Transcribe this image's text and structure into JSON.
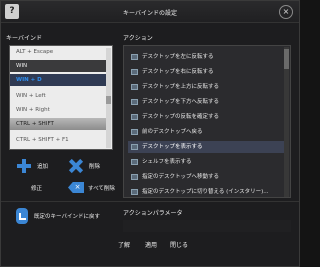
{
  "title": "キーバインドの設定",
  "left_panel": {
    "header": "キーバインド",
    "items": [
      {
        "label": "ALT + Escape",
        "state": "normal"
      },
      {
        "label": "WIN",
        "state": "selected"
      },
      {
        "label": "WIN + D",
        "state": "highlight"
      },
      {
        "label": "WIN + Left",
        "state": "normal"
      },
      {
        "label": "WIN + Right",
        "state": "normal"
      },
      {
        "label": "CTRL + SHIFT",
        "state": "selected"
      },
      {
        "label": "CTRL + SHIFT + F1",
        "state": "normal"
      }
    ],
    "add_label": "追加",
    "delete_label": "削除",
    "edit_label": "修正",
    "clear_all_label": "すべて削除",
    "restore_label": "既定のキーバインドに戻す"
  },
  "right_panel": {
    "header": "アクション",
    "actions": [
      {
        "label": "デスクトップを左に反転する",
        "state": "normal"
      },
      {
        "label": "デスクトップを右に反転する",
        "state": "normal"
      },
      {
        "label": "デスクトップを上方に反転する",
        "state": "normal"
      },
      {
        "label": "デスクトップを下方へ反転する",
        "state": "normal"
      },
      {
        "label": "デスクトップの反転を確定する",
        "state": "normal"
      },
      {
        "label": "前のデスクトップへ戻る",
        "state": "normal"
      },
      {
        "label": "デスクトップを表示する",
        "state": "selected"
      },
      {
        "label": "シェルフを表示する",
        "state": "normal"
      },
      {
        "label": "指定のデスクトップへ移動する",
        "state": "normal"
      },
      {
        "label": "指定のデスクトップに切り替える (インスタリー)...",
        "state": "normal"
      }
    ],
    "param_header": "アクションパラメータ"
  },
  "buttons": {
    "apply": "了解",
    "accept": "適用",
    "close": "閉じる"
  }
}
